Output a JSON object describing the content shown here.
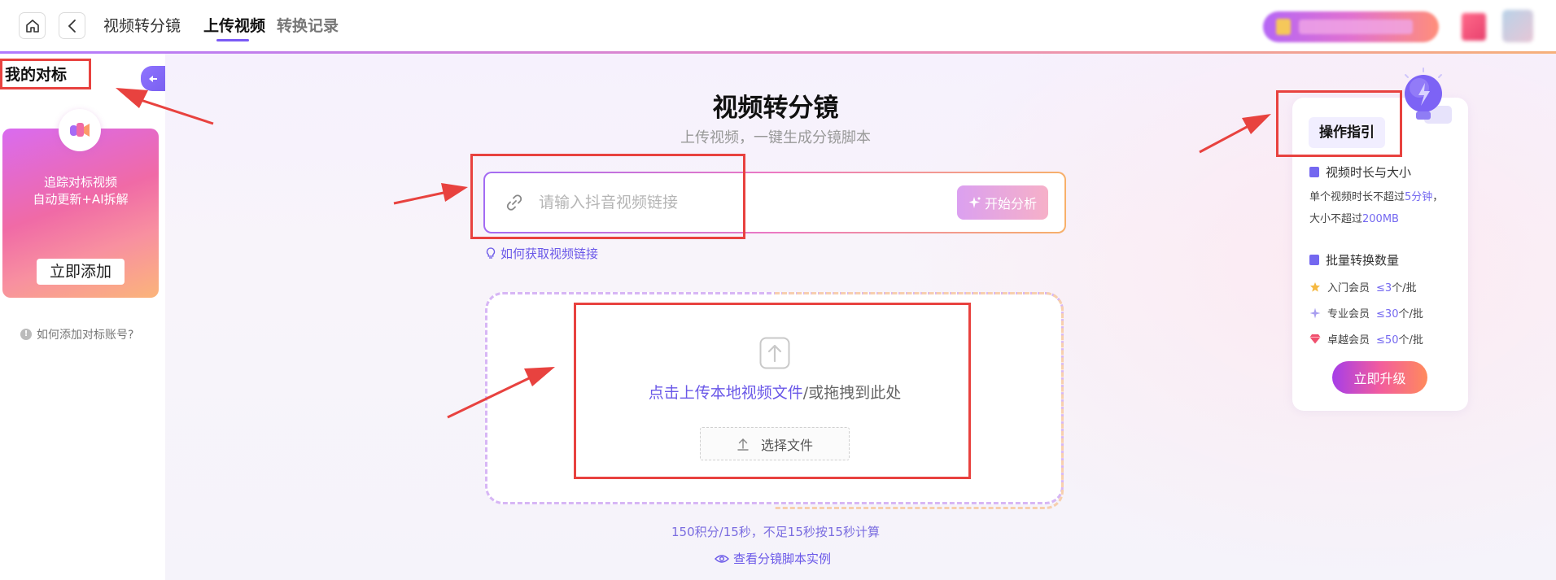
{
  "header": {
    "breadcrumb_title": "视频转分镜",
    "tabs": [
      {
        "label": "上传视频",
        "active": true
      },
      {
        "label": "转换记录",
        "active": false
      }
    ],
    "accent_color": "#7a5af5"
  },
  "sidebar": {
    "title": "我的对标",
    "card": {
      "line1": "追踪对标视频",
      "line2": "自动更新+AI拆解",
      "button_label": "立即添加"
    },
    "help_text": "如何添加对标账号?"
  },
  "main": {
    "title": "视频转分镜",
    "subtitle": "上传视频，一键生成分镜脚本",
    "link_input": {
      "placeholder": "请输入抖音视频链接",
      "value": ""
    },
    "analyze_button": "开始分析",
    "how_to_get_link": "如何获取视频链接",
    "upload": {
      "text_accent": "点击上传本地视频文件",
      "text_rest": "/或拖拽到此处",
      "choose_button": "选择文件"
    },
    "cost_note": "150积分/15秒，不足15秒按15秒计算",
    "sample_link": "查看分镜脚本实例"
  },
  "guide": {
    "title": "操作指引",
    "section1": {
      "title": "视频时长与大小",
      "line1_prefix": "单个视频时长不超过",
      "line1_value": "5分钟",
      "line1_suffix": "，",
      "line2_prefix": "大小不超过",
      "line2_value": "200MB"
    },
    "section2": {
      "title": "批量转换数量",
      "tiers": [
        {
          "name": "入门会员",
          "prefix": "≤",
          "value": "3",
          "suffix": "个/批",
          "color": "#f5b942"
        },
        {
          "name": "专业会员",
          "prefix": "≤",
          "value": "30",
          "suffix": "个/批",
          "color": "#a89ef0"
        },
        {
          "name": "卓越会员",
          "prefix": "≤",
          "value": "50",
          "suffix": "个/批",
          "color": "#f0506e"
        }
      ]
    },
    "upgrade_button": "立即升级"
  }
}
